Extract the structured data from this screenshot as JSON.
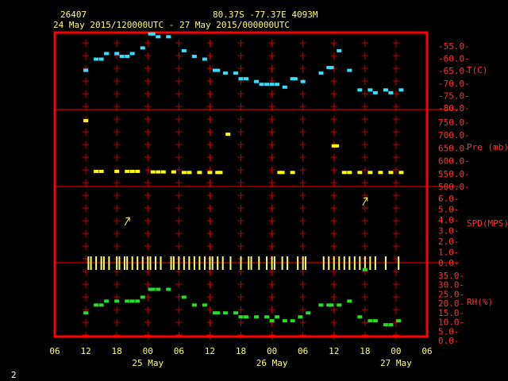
{
  "header": {
    "station": "26407",
    "location": "80.37S   -77.37E   4093M",
    "period": "24 May 2015/120000UTC - 27 May 2015/000000UTC"
  },
  "footer": {
    "page_number": "2"
  },
  "colors": {
    "background": "#000000",
    "frame": "#ff0000",
    "grid": "#c00000",
    "text_yellow": "#ffff66",
    "axis_labels": "#ff3333",
    "temp": "#33e0ff",
    "pressure": "#ffff00",
    "wind": "#ffff66",
    "rh": "#22e022"
  },
  "chart_data": {
    "type": "scatter",
    "x_unit": "hours",
    "x_ticks": [
      "06",
      "12",
      "18",
      "00",
      "06",
      "12",
      "18",
      "00",
      "06",
      "12",
      "18",
      "00",
      "06"
    ],
    "day_labels": [
      "25 May",
      "26 May",
      "27 May"
    ],
    "panels": [
      {
        "name": "T(C)",
        "tick_labels": [
          "-55.0-",
          "-60.0-",
          "-65.0-",
          "-70.0-",
          "-75.0-",
          "-80.0-"
        ],
        "ylim": [
          -80,
          -52.5
        ],
        "color": "temp",
        "points": [
          [
            12,
            -66
          ],
          [
            14,
            -62
          ],
          [
            15,
            -62
          ],
          [
            16,
            -60
          ],
          [
            18,
            -60
          ],
          [
            19,
            -61
          ],
          [
            20,
            -61
          ],
          [
            21,
            -60
          ],
          [
            23,
            -58
          ],
          [
            24.5,
            -53
          ],
          [
            25,
            -53
          ],
          [
            26,
            -54
          ],
          [
            28,
            -54
          ],
          [
            31,
            -59
          ],
          [
            33,
            -61
          ],
          [
            35,
            -62
          ],
          [
            37,
            -66
          ],
          [
            37.5,
            -66
          ],
          [
            39,
            -67
          ],
          [
            41,
            -67
          ],
          [
            42,
            -69
          ],
          [
            43,
            -69
          ],
          [
            45,
            -70
          ],
          [
            46,
            -71
          ],
          [
            47,
            -71
          ],
          [
            48,
            -71
          ],
          [
            49,
            -71
          ],
          [
            50.5,
            -72
          ],
          [
            52,
            -69
          ],
          [
            52.5,
            -69
          ],
          [
            54,
            -70
          ],
          [
            57.5,
            -67
          ],
          [
            59,
            -65
          ],
          [
            59.5,
            -65
          ],
          [
            61,
            -59
          ],
          [
            63,
            -66
          ],
          [
            65,
            -73
          ],
          [
            67,
            -73
          ],
          [
            68,
            -74
          ],
          [
            70,
            -73
          ],
          [
            71,
            -74
          ],
          [
            73,
            -73
          ]
        ]
      },
      {
        "name": "Pre (mb)",
        "tick_labels": [
          "750.0-",
          "700.0-",
          "650.0-",
          "600.0-",
          "550.0-",
          "500.0-"
        ],
        "ylim": [
          500,
          790
        ],
        "color": "pressure",
        "points": [
          [
            12,
            748
          ],
          [
            14,
            557
          ],
          [
            15,
            557
          ],
          [
            18,
            557
          ],
          [
            20,
            557
          ],
          [
            21,
            557
          ],
          [
            22,
            557
          ],
          [
            25,
            555
          ],
          [
            26,
            555
          ],
          [
            27,
            555
          ],
          [
            29,
            555
          ],
          [
            31,
            553
          ],
          [
            32,
            553
          ],
          [
            34,
            553
          ],
          [
            36,
            553
          ],
          [
            37.5,
            553
          ],
          [
            38,
            553
          ],
          [
            39.5,
            697
          ],
          [
            49.5,
            553
          ],
          [
            50,
            553
          ],
          [
            52,
            553
          ],
          [
            60,
            653
          ],
          [
            60.5,
            653
          ],
          [
            62,
            553
          ],
          [
            63,
            553
          ],
          [
            65,
            553
          ],
          [
            67,
            553
          ],
          [
            69,
            553
          ],
          [
            71,
            553
          ],
          [
            73,
            553
          ]
        ]
      },
      {
        "name": "SPD(MPS)",
        "tick_labels": [
          "6.0-",
          "5.0-",
          "4.0-",
          "3.0-",
          "2.0-",
          "1.0-",
          "0.0-"
        ],
        "ylim": [
          0,
          6.5
        ],
        "color": "wind",
        "arrows": [
          {
            "x": 20,
            "y": 3.6
          },
          {
            "x": 66,
            "y": 5.3
          }
        ],
        "sticks": [
          12.5,
          13,
          14,
          15,
          15.5,
          16.5,
          18,
          18.5,
          19.5,
          20,
          21,
          22,
          23,
          24,
          24.5,
          25.5,
          26.5,
          28.5,
          29,
          30,
          31,
          32,
          33,
          34,
          35,
          36,
          36.5,
          37.5,
          38.5,
          40,
          42,
          43.5,
          44,
          45.5,
          47,
          48,
          48.5,
          50,
          51,
          53,
          54,
          54.5,
          58,
          59,
          60,
          61,
          62,
          63,
          64,
          65,
          66,
          67,
          68,
          70,
          72.5
        ]
      },
      {
        "name": "RH(%)",
        "tick_labels": [
          "35.0-",
          "30.0-",
          "25.0-",
          "20.0-",
          "15.0-",
          "10.0-",
          "5.0-",
          "0.0-"
        ],
        "ylim": [
          0,
          37.5
        ],
        "color": "rh",
        "points": [
          [
            12,
            12
          ],
          [
            14,
            16
          ],
          [
            15,
            16
          ],
          [
            16,
            18
          ],
          [
            18,
            18
          ],
          [
            20,
            18
          ],
          [
            21,
            18
          ],
          [
            22,
            18
          ],
          [
            23,
            20
          ],
          [
            24.5,
            24
          ],
          [
            25,
            24
          ],
          [
            26,
            24
          ],
          [
            28,
            24
          ],
          [
            31,
            20
          ],
          [
            33,
            16
          ],
          [
            35,
            16
          ],
          [
            37,
            12
          ],
          [
            37.5,
            12
          ],
          [
            39,
            12
          ],
          [
            41,
            12
          ],
          [
            42,
            10
          ],
          [
            43,
            10
          ],
          [
            45,
            10
          ],
          [
            47,
            10
          ],
          [
            48,
            8
          ],
          [
            49,
            10
          ],
          [
            50.5,
            8
          ],
          [
            52,
            8
          ],
          [
            53.5,
            10
          ],
          [
            55,
            12
          ],
          [
            57.5,
            16
          ],
          [
            59,
            16
          ],
          [
            59.5,
            16
          ],
          [
            61,
            16
          ],
          [
            63,
            18
          ],
          [
            65,
            10
          ],
          [
            67,
            8
          ],
          [
            68,
            8
          ],
          [
            70,
            6
          ],
          [
            71,
            6
          ],
          [
            72.5,
            8
          ],
          [
            66,
            34
          ]
        ]
      }
    ]
  }
}
